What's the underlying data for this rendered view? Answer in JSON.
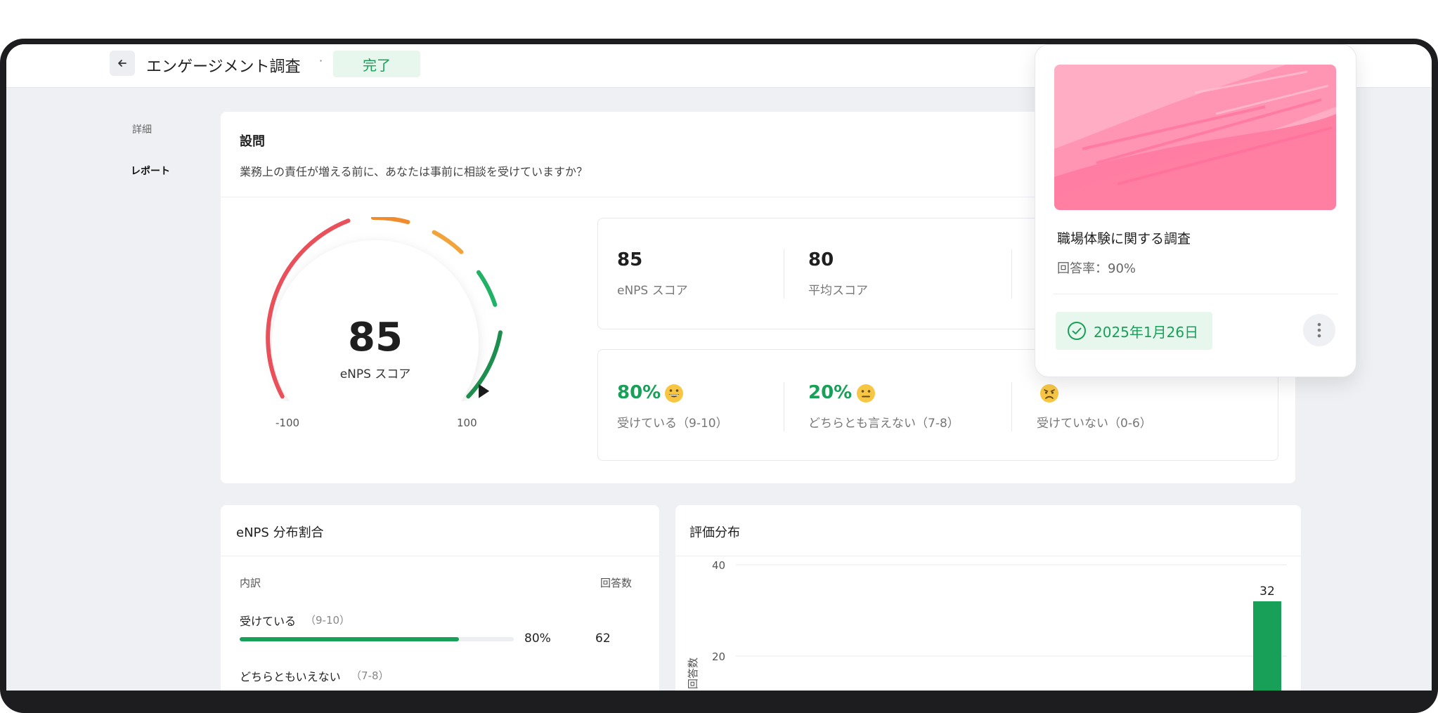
{
  "header": {
    "title": "エンゲージメント調査",
    "separator": "·",
    "status": "完了"
  },
  "sidenav": {
    "items": [
      {
        "label": "詳細",
        "active": false
      },
      {
        "label": "レポート",
        "active": true
      }
    ]
  },
  "question": {
    "heading": "設問",
    "text": "業務上の責任が増える前に、あなたは事前に相談を受けていますか？"
  },
  "gauge": {
    "value": "85",
    "label": "eNPS スコア",
    "min_label": "-100",
    "max_label": "100",
    "score_fraction": 0.925
  },
  "scores": [
    {
      "value": "85",
      "label": "eNPS スコア"
    },
    {
      "value": "80",
      "label": "平均スコア"
    }
  ],
  "breakdown": [
    {
      "percent": "80%",
      "label": "受けている（9-10）",
      "emoji": "grinning-face-icon"
    },
    {
      "percent": "20%",
      "label": "どちらとも言えない（7-8）",
      "emoji": "neutral-face-icon"
    },
    {
      "percent": "",
      "label": "受けていない（0-6）",
      "emoji": "frowning-face-icon"
    }
  ],
  "distribution": {
    "title": "eNPS 分布割合",
    "col_breakdown": "内訳",
    "col_count": "回答数",
    "rows": [
      {
        "label": "受けている",
        "range": "（9-10）",
        "percent": "80%",
        "fraction": 0.8,
        "count": "62"
      },
      {
        "label": "どちらともいえない",
        "range": "（7-8）"
      }
    ]
  },
  "rating": {
    "title": "評価分布",
    "ylabel": "回答数"
  },
  "chart_data": {
    "type": "bar",
    "title": "評価分布",
    "ylabel": "回答数",
    "yticks": [
      "40",
      "20"
    ],
    "ylim": [
      0,
      40
    ],
    "visible_bars": [
      {
        "category": "",
        "value": 32,
        "label": "32"
      }
    ],
    "grid": true
  },
  "popover": {
    "title": "職場体験に関する調査",
    "response_rate": "回答率：90%",
    "date": "2025年1月26日"
  },
  "colors": {
    "accent_green": "#18a058",
    "gauge_red": "#e9505a",
    "gauge_orange": "#f08c2e",
    "gauge_yellow": "#f2a33a",
    "gauge_green": "#22b265",
    "gauge_dark_green": "#1e8e4f",
    "popover_pink": "#ff9eb8"
  }
}
